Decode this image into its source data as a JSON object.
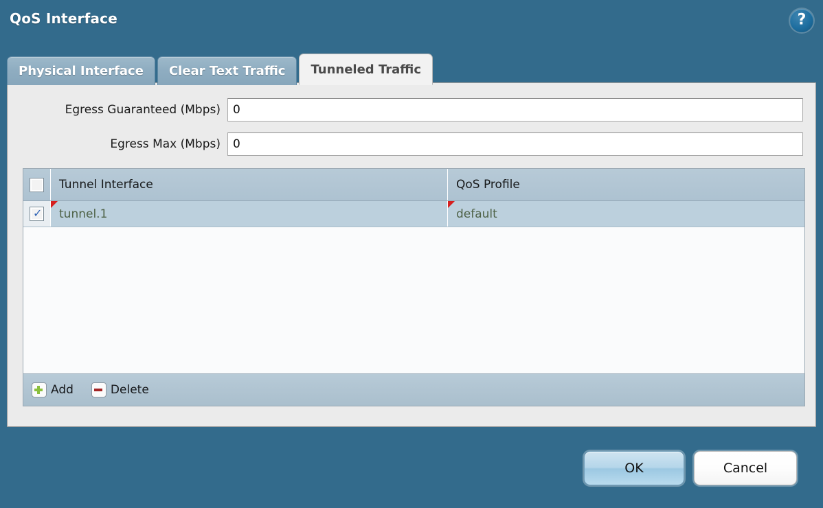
{
  "dialog": {
    "title": "QoS Interface",
    "help_icon": "help-question-icon",
    "help_glyph": "?"
  },
  "tabs": [
    {
      "label": "Physical Interface",
      "active": false
    },
    {
      "label": "Clear Text Traffic",
      "active": false
    },
    {
      "label": "Tunneled Traffic",
      "active": true
    }
  ],
  "form": {
    "egress_guaranteed": {
      "label": "Egress Guaranteed (Mbps)",
      "value": "0",
      "placeholder": ""
    },
    "egress_max": {
      "label": "Egress Max (Mbps)",
      "value": "0",
      "placeholder": ""
    }
  },
  "table": {
    "columns": [
      "Tunnel Interface",
      "QoS Profile"
    ],
    "header_select_all_checked": false,
    "rows": [
      {
        "checked": true,
        "tunnel_interface": "tunnel.1",
        "qos_profile": "default"
      }
    ],
    "toolbar": {
      "add_label": "Add",
      "delete_label": "Delete",
      "add_icon": "plus-icon",
      "delete_icon": "minus-icon"
    }
  },
  "footer": {
    "ok_label": "OK",
    "cancel_label": "Cancel"
  },
  "colors": {
    "header_blue": "#336b8c",
    "panel_bg": "#ebebeb",
    "table_header": "#adc2d1",
    "row_selected": "#bcd0dd",
    "row_text": "#4e6247",
    "flag_red": "#d61f1f",
    "add_green": "#8bbf3d",
    "delete_red": "#a32525"
  }
}
